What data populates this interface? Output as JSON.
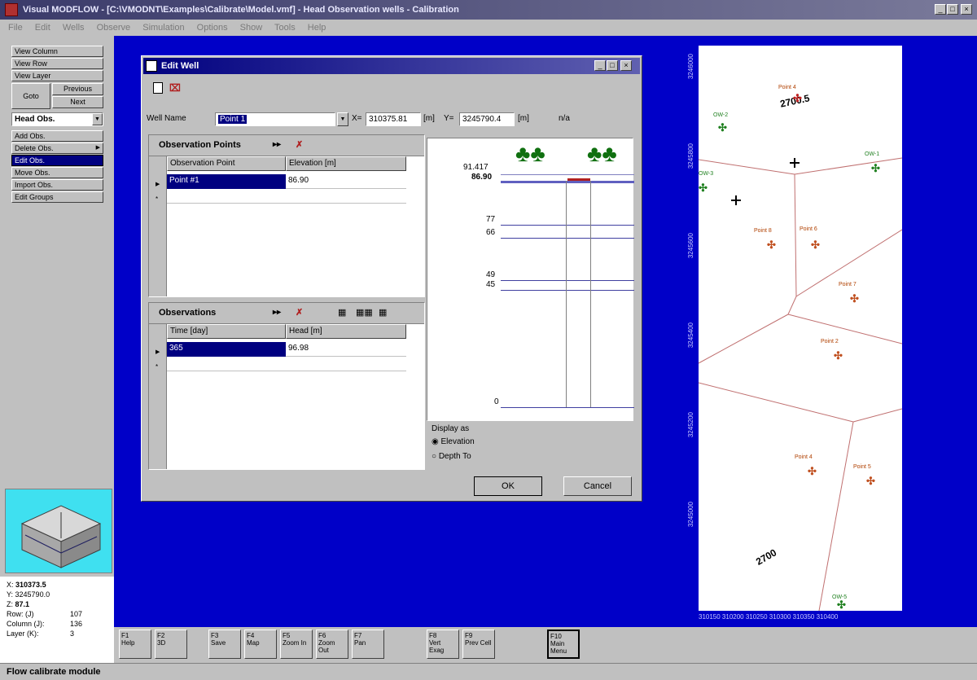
{
  "window": {
    "title": "Visual MODFLOW - [C:\\VMODNT\\Examples\\Calibrate\\Model.vmf] - Head Observation wells - Calibration",
    "min": "_",
    "max": "□",
    "close": "×"
  },
  "menu": [
    "File",
    "Edit",
    "Wells",
    "Observe",
    "Simulation",
    "Options",
    "Show",
    "Tools",
    "Help"
  ],
  "left_panel": {
    "view_column": "View Column",
    "view_row": "View Row",
    "view_layer": "View Layer",
    "goto": "Goto",
    "previous": "Previous",
    "next": "Next",
    "dropdown": "Head Obs.",
    "add_obs": "Add Obs.",
    "delete_obs": "Delete Obs.",
    "edit_obs": "Edit Obs.",
    "move_obs": "Move Obs.",
    "import_obs": "Import Obs.",
    "edit_groups": "Edit Groups"
  },
  "coords": {
    "x_label": "X:",
    "x": "310373.5",
    "y_label": "Y:",
    "y": "3245790.0",
    "z_label": "Z:",
    "z": "87.1",
    "row_label": "Row:",
    "row_hint": "(J)",
    "row": "107",
    "col_label": "Column (J):",
    "col": "136",
    "layer_label": "Layer (K):",
    "layer": "3"
  },
  "dialog": {
    "title": "Edit Well",
    "well_name_label": "Well Name",
    "well_name": "Point 1",
    "x_label": "X=",
    "x_value": "310375.81",
    "x_unit": "[m]",
    "y_label": "Y=",
    "y_value": "3245790.4",
    "y_unit": "[m]",
    "na": "n/a",
    "obs_points_title": "Observation Points",
    "obs_points_cols": [
      "Observation Point",
      "Elevation [m]"
    ],
    "obs_points_rows": [
      [
        "Point #1",
        "86.90"
      ]
    ],
    "observations_title": "Observations",
    "observations_cols": [
      "Time [day]",
      "Head [m]"
    ],
    "observations_rows": [
      [
        "365",
        "96.98"
      ]
    ],
    "profile_labels": [
      "91.417",
      "86.90",
      "77",
      "66",
      "49",
      "45",
      "0"
    ],
    "display_as": "Display as",
    "elevation": "Elevation",
    "depth_to": "Depth To",
    "ok": "OK",
    "cancel": "Cancel",
    "min": "_",
    "max": "□",
    "close": "×"
  },
  "map": {
    "wells": [
      {
        "label": "Point 4",
        "num": "2700.5"
      },
      {
        "label": "OW-2"
      },
      {
        "label": "OW-1"
      },
      {
        "label": "OW-3"
      },
      {
        "label": "Point 8"
      },
      {
        "label": "Point 6"
      },
      {
        "label": "Point 7"
      },
      {
        "label": "Point 2"
      },
      {
        "label": "Point 4"
      },
      {
        "label": "Point 5"
      },
      {
        "label": "OW-5"
      }
    ],
    "contour_label": "2700",
    "ruler_left": [
      "3246000",
      "3245800",
      "3245600",
      "3245400",
      "3245200",
      "3245000"
    ],
    "ruler_bottom": "310150  310200  310250  310300  310350  310400"
  },
  "toolbar": [
    {
      "key": "F1",
      "label": "Help"
    },
    {
      "key": "F2",
      "label": "3D"
    },
    {
      "key": "F3",
      "label": "Save"
    },
    {
      "key": "F4",
      "label": "Map"
    },
    {
      "key": "F5",
      "label": "Zoom In"
    },
    {
      "key": "F6",
      "label": "Zoom Out"
    },
    {
      "key": "F7",
      "label": "Pan"
    },
    {
      "key": "F8",
      "label": "Vert Exag"
    },
    {
      "key": "F9",
      "label": "Prev Cell"
    },
    {
      "key": "F10",
      "label": "Main Menu"
    }
  ],
  "status": "Flow calibrate module"
}
